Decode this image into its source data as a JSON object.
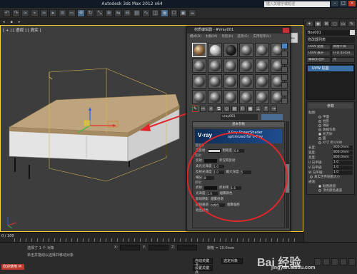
{
  "app": {
    "title": "Autodesk 3ds Max 2012 x64",
    "search_placeholder": "键入关键字或短语"
  },
  "viewport": {
    "label": "[ + ] [ 透视 ] [ 真实 ]"
  },
  "material_editor": {
    "title": "材质编辑器 - #Vray001",
    "menu": [
      "模式(D)",
      "材质(M)",
      "导航(N)",
      "选项(O)",
      "实用程序(U)"
    ],
    "material_name": "vray001",
    "rollout_title": "基本参数",
    "vray_logo": "V·ray",
    "vray_line1": "V-Ray PowerShader",
    "vray_line2": "optimized for V-Ray",
    "diffuse_group": "漫反射",
    "diffuse_label": "漫反射",
    "roughness_label": "粗糙度",
    "roughness_value": "0.0",
    "reflect_group": "反射",
    "reflect_label": "反射",
    "reflect_gloss": "高光光泽度",
    "reflect_gloss_value": "1.0",
    "reflect_fresnel": "菲涅耳反射",
    "refl_gloss": "反射光泽度",
    "refl_gloss_value": "1.0",
    "subdivs": "细分",
    "subdivs_value": "8",
    "max_depth": "最大深度",
    "max_depth_value": "5",
    "refract_group": "折射",
    "refract_label": "折射",
    "ior_label": "折射率",
    "ior_value": "1.6",
    "gloss_label": "光泽度",
    "gloss_value": "1.0",
    "affect_shadows": "影响阴影",
    "exit_color": "退出颜色",
    "affect_channels": "影响通道",
    "channels_value": "仅颜色",
    "fog_color": "烟雾颜色",
    "fog_mult": "烟雾倍增",
    "fog_bias": "烟雾偏移"
  },
  "command_panel": {
    "object_name": "Box001",
    "modifier_list": "修改器列表",
    "buttons": [
      "UVW 贴图",
      "网格平滑",
      "UVW 展开",
      "FFD 4x4x4",
      "编辑多边形",
      "壳"
    ],
    "stack_item": "UVW 贴图",
    "params_header": "参数",
    "mapping_header": "贴图:",
    "mapping_options": [
      "平面",
      "柱形",
      "球形",
      "收缩包裹",
      "长方体",
      "面",
      "XYZ 到 UVW"
    ],
    "length_label": "长度:",
    "length_value": "800.0mm",
    "width_label": "宽度:",
    "width_value": "800.0mm",
    "height_label": "高度:",
    "height_value": "800.0mm",
    "u_tile": "U 向平铺:",
    "u_tile_value": "1.0",
    "v_tile": "V 向平铺:",
    "v_tile_value": "1.0",
    "w_tile": "W 向平铺:",
    "w_tile_value": "1.0",
    "realworld": "真实世界贴图大小",
    "channel_header": "通道:",
    "channel_options": [
      "贴图通道:",
      "顶点颜色通道"
    ]
  },
  "timeline": {
    "frame": "0 / 100"
  },
  "statusbar": {
    "selected": "选择了 1 个 对象",
    "prompt": "单击并拖动以选择并移动对象",
    "red_label": "欢迎使用 M",
    "x_label": "X:",
    "y_label": "Y:",
    "z_label": "Z:",
    "grid": "栅格 = 10.0mm",
    "autokey": "自动关键点",
    "setkey": "设置关键点",
    "selected_mode": "选定对象",
    "watermark": "Bai 经验",
    "watermark_url": "jingyan.baidu.com"
  },
  "colors": {
    "accent": "#ffd23a",
    "arrow": "#e0262b",
    "circle": "#e0262b"
  }
}
